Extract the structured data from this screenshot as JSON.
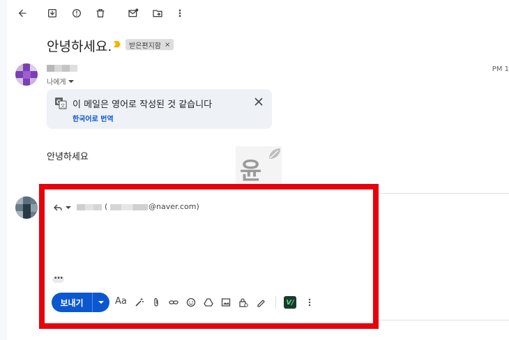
{
  "toolbar": {
    "icons": [
      "back-arrow-icon",
      "archive-icon",
      "report-spam-icon",
      "delete-icon",
      "mark-unread-icon",
      "move-to-icon",
      "more-vert-icon"
    ]
  },
  "email": {
    "subject": "안녕하세요.",
    "label_chip": "받은편지함",
    "label_chip_close": "×",
    "recipient_line": "나에게",
    "time": "PM 1",
    "translate": {
      "message": "이 메일은 영어로 작성된 것 같습니다",
      "link": "한국어로 번역"
    },
    "body": "안녕하세요"
  },
  "watermark": {
    "text": "윤"
  },
  "reply": {
    "paren_open": "(",
    "email_suffix": "@naver.com)",
    "ellipsis": "•••",
    "send_label": "보내기",
    "format_label": "Aa",
    "ext_label": "V/"
  },
  "colors": {
    "send_button": "#0b57d0",
    "highlight_box": "#e8000b",
    "translate_bg": "#eef1f6",
    "important_marker": "#f4b400"
  }
}
